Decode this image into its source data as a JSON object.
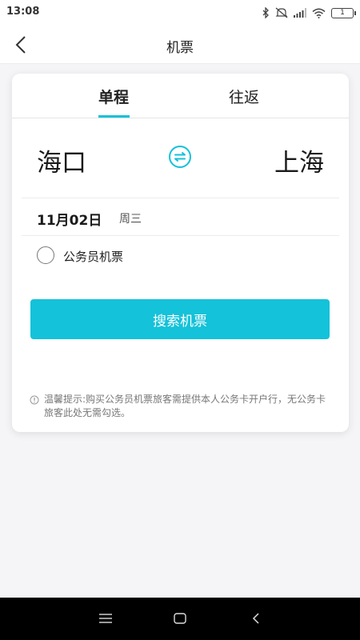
{
  "status_bar": {
    "time": "13:08",
    "battery_level": "1",
    "icons": [
      "bluetooth-icon",
      "mute-icon",
      "signal-icon",
      "wifi-icon",
      "battery-icon"
    ]
  },
  "header": {
    "title": "机票",
    "back_icon": "chevron-left-icon"
  },
  "tabs": [
    {
      "label": "单程",
      "active": true
    },
    {
      "label": "往返",
      "active": false
    }
  ],
  "route": {
    "from_city": "海口",
    "to_city": "上海",
    "swap_icon": "swap-icon"
  },
  "date": {
    "day": "11月02日",
    "weekday": "周三"
  },
  "civil_servant": {
    "label": "公务员机票",
    "checked": false
  },
  "search": {
    "label": "搜索机票"
  },
  "notice": {
    "icon": "info-icon",
    "text": "温馨提示:购买公务员机票旅客需提供本人公务卡开户行，无公务卡旅客此处无需勾选。"
  },
  "colors": {
    "accent": "#14c2d9",
    "background": "#f5f5f7",
    "card": "#ffffff"
  },
  "nav": {
    "icons": [
      "menu-icon",
      "home-icon",
      "back-icon"
    ]
  }
}
